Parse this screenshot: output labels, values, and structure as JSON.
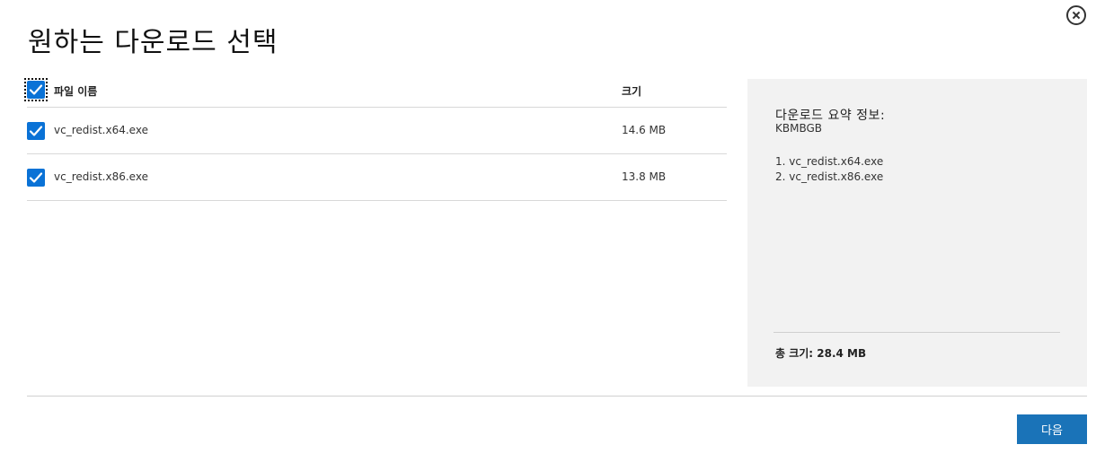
{
  "dialog": {
    "title": "원하는 다운로드 선택",
    "close_icon": "close-circle-icon"
  },
  "table": {
    "header": {
      "name": "파일 이름",
      "size": "크기",
      "select_all_checked": true
    },
    "rows": [
      {
        "name": "vc_redist.x64.exe",
        "size": "14.6 MB",
        "checked": true
      },
      {
        "name": "vc_redist.x86.exe",
        "size": "13.8 MB",
        "checked": true
      }
    ]
  },
  "summary": {
    "title": "다운로드 요약 정보:",
    "kb": "KBMBGB",
    "items": [
      "1. vc_redist.x64.exe",
      "2. vc_redist.x86.exe"
    ],
    "total": "총 크기: 28.4 MB"
  },
  "footer": {
    "next_label": "다음"
  },
  "colors": {
    "checkbox": "#0a72d6",
    "button": "#1a73b8",
    "panel": "#f2f2f2"
  }
}
